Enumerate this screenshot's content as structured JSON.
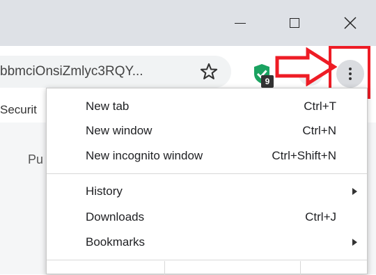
{
  "omnibox": {
    "url_text": "bbmciOnsiZmlyc3RQY..."
  },
  "extension": {
    "badge_count": "9"
  },
  "bookmarks_bar": {
    "partial_item": "Securit"
  },
  "page": {
    "partial_text": "Pu"
  },
  "annotation": {
    "color": "#ee1c25"
  },
  "menu": {
    "items": [
      {
        "label": "New tab",
        "shortcut": "Ctrl+T"
      },
      {
        "label": "New window",
        "shortcut": "Ctrl+N"
      },
      {
        "label": "New incognito window",
        "shortcut": "Ctrl+Shift+N"
      },
      {
        "label": "History",
        "shortcut": ""
      },
      {
        "label": "Downloads",
        "shortcut": "Ctrl+J"
      },
      {
        "label": "Bookmarks",
        "shortcut": ""
      }
    ]
  }
}
